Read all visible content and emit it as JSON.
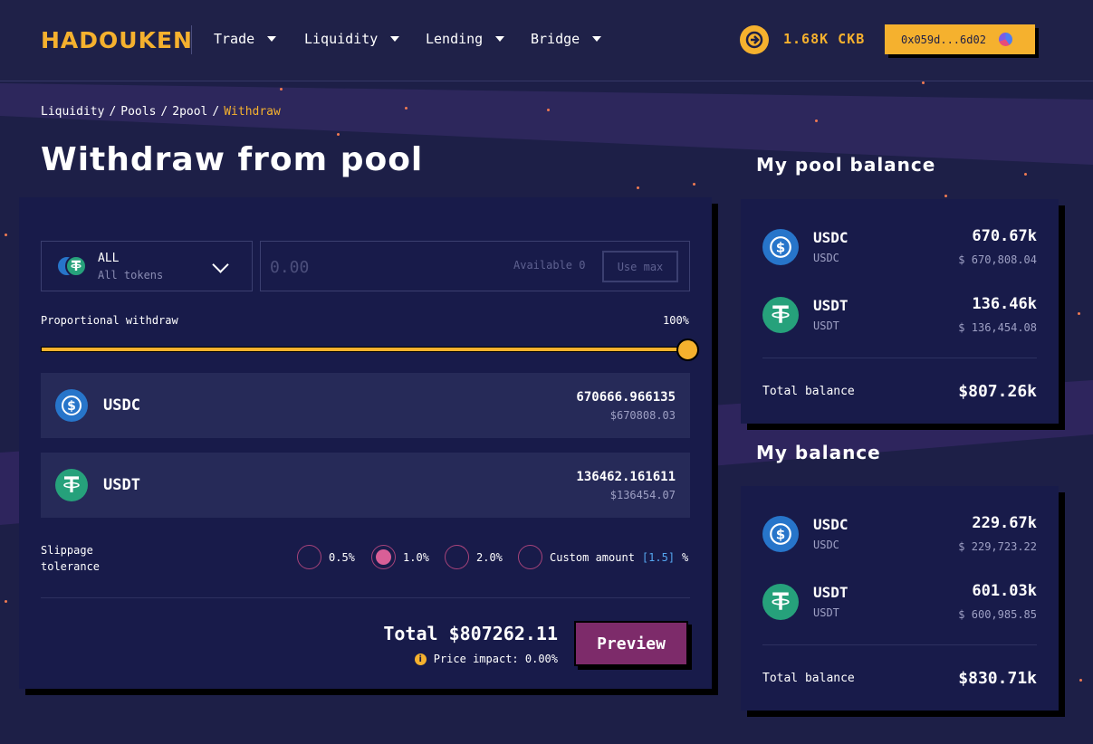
{
  "header": {
    "logo": "HADOUKEN",
    "nav": [
      {
        "label": "Trade"
      },
      {
        "label": "Liquidity"
      },
      {
        "label": "Lending"
      },
      {
        "label": "Bridge"
      }
    ],
    "balance": "1.68K CKB",
    "wallet_address": "0x059d...6d02"
  },
  "breadcrumb": {
    "items": [
      "Liquidity",
      "Pools",
      "2pool"
    ],
    "current": "Withdraw",
    "separator": "/"
  },
  "page_title": "Withdraw from pool",
  "withdraw_form": {
    "token_select": {
      "label": "ALL",
      "sublabel": "All tokens"
    },
    "amount_placeholder": "0.00",
    "available": "Available 0",
    "use_max_label": "Use max",
    "proportional_label": "Proportional withdraw",
    "proportional_value": "100%",
    "slider_fraction": 1.0,
    "tokens": [
      {
        "symbol": "USDC",
        "amount": "670666.966135",
        "usd": "$670808.03"
      },
      {
        "symbol": "USDT",
        "amount": "136462.161611",
        "usd": "$136454.07"
      }
    ],
    "slippage": {
      "label_line1": "Slippage",
      "label_line2": "tolerance",
      "options": [
        {
          "label": "0.5%",
          "selected": false
        },
        {
          "label": "1.0%",
          "selected": true
        },
        {
          "label": "2.0%",
          "selected": false
        }
      ],
      "custom_label": "Custom amount",
      "custom_value": "[1.5]",
      "custom_unit": "%"
    },
    "total": "Total $807262.11",
    "price_impact": "Price impact: 0.00%",
    "preview_label": "Preview"
  },
  "pool_balance": {
    "title": "My pool balance",
    "rows": [
      {
        "symbol": "USDC",
        "sub": "USDC",
        "value": "670.67k",
        "usd": "$ 670,808.04"
      },
      {
        "symbol": "USDT",
        "sub": "USDT",
        "value": "136.46k",
        "usd": "$ 136,454.08"
      }
    ],
    "total_label": "Total balance",
    "total_value": "$807.26k"
  },
  "my_balance": {
    "title": "My balance",
    "rows": [
      {
        "symbol": "USDC",
        "sub": "USDC",
        "value": "229.67k",
        "usd": "$ 229,723.22"
      },
      {
        "symbol": "USDT",
        "sub": "USDT",
        "value": "601.03k",
        "usd": "$ 600,985.85"
      }
    ],
    "total_label": "Total balance",
    "total_value": "$830.71k"
  },
  "colors": {
    "accent": "#f5b12e",
    "background": "#1d1f47",
    "card": "#181b4a",
    "preview_button": "#7d2b6a",
    "usdc": "#2775ca",
    "usdt": "#26a17b"
  }
}
